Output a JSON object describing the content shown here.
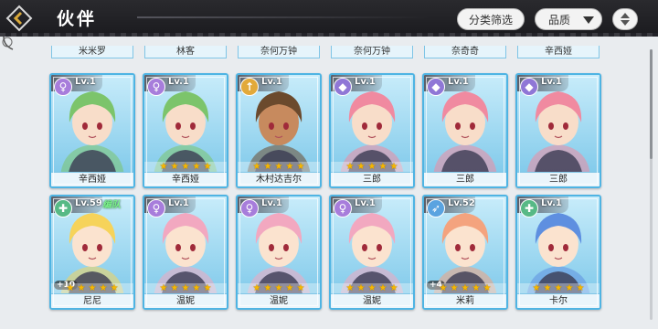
{
  "header": {
    "title": "伙伴",
    "filter_label": "分类筛选",
    "quality_label": "品质"
  },
  "colors": {
    "topbar": "#1b1b1f",
    "card_border": "#4fb4e3",
    "card_bg": "#8fd2ee",
    "star": "#f7b800",
    "team_tag": "#7cf08a"
  },
  "previous_row_names": [
    "米米罗",
    "林客",
    "奈何万钟",
    "奈何万钟",
    "奈奇奇",
    "辛西娅"
  ],
  "rows": [
    [
      {
        "name": "辛西娅",
        "level": "Lv.1",
        "class_icon": "female-icon",
        "icon_color": "ic-purple",
        "stars": 0,
        "team": "",
        "plus": "",
        "hair": "#7cc46b",
        "skin": "#f8ddc9"
      },
      {
        "name": "辛西娅",
        "level": "Lv.1",
        "class_icon": "female-icon",
        "icon_color": "ic-purple",
        "stars": 5,
        "team": "",
        "plus": "",
        "hair": "#7cc46b",
        "skin": "#f8ddc9"
      },
      {
        "name": "木村达吉尔",
        "level": "Lv.1",
        "class_icon": "arrow-up-icon",
        "icon_color": "ic-orange",
        "stars": 5,
        "team": "",
        "plus": "",
        "hair": "#6b4a2d",
        "skin": "#c78a5e"
      },
      {
        "name": "三郎",
        "level": "Lv.1",
        "class_icon": "shield-icon",
        "icon_color": "ic-violet",
        "stars": 5,
        "team": "",
        "plus": "",
        "hair": "#f08aa0",
        "skin": "#f8ddc9"
      },
      {
        "name": "三郎",
        "level": "Lv.1",
        "class_icon": "shield-icon",
        "icon_color": "ic-violet",
        "stars": 0,
        "team": "",
        "plus": "",
        "hair": "#f08aa0",
        "skin": "#f8ddc9"
      },
      {
        "name": "三郎",
        "level": "Lv.1",
        "class_icon": "shield-icon",
        "icon_color": "ic-violet",
        "stars": 0,
        "team": "",
        "plus": "",
        "hair": "#f08aa0",
        "skin": "#f8ddc9"
      }
    ],
    [
      {
        "name": "尼尼",
        "level": "Lv.59",
        "class_icon": "cross-icon",
        "icon_color": "ic-green",
        "stars": 5,
        "team": "编队",
        "plus": "+10",
        "hair": "#f6d35a",
        "skin": "#fbe3cf"
      },
      {
        "name": "温妮",
        "level": "Lv.1",
        "class_icon": "female-icon",
        "icon_color": "ic-purple",
        "stars": 5,
        "team": "",
        "plus": "",
        "hair": "#f2a8c0",
        "skin": "#fbe3cf"
      },
      {
        "name": "温妮",
        "level": "Lv.1",
        "class_icon": "female-icon",
        "icon_color": "ic-purple",
        "stars": 5,
        "team": "",
        "plus": "",
        "hair": "#f2a8c0",
        "skin": "#fbe3cf"
      },
      {
        "name": "温妮",
        "level": "Lv.1",
        "class_icon": "female-icon",
        "icon_color": "ic-purple",
        "stars": 5,
        "team": "",
        "plus": "",
        "hair": "#f2a8c0",
        "skin": "#fbe3cf"
      },
      {
        "name": "米莉",
        "level": "Lv.52",
        "class_icon": "bow-icon",
        "icon_color": "ic-blue",
        "stars": 5,
        "team": "",
        "plus": "+4",
        "hair": "#f4a37e",
        "skin": "#fbe3cf"
      },
      {
        "name": "卡尔",
        "level": "Lv.1",
        "class_icon": "cross-icon",
        "icon_color": "ic-green",
        "stars": 5,
        "team": "",
        "plus": "",
        "hair": "#5e8fe0",
        "skin": "#fbe3cf"
      }
    ]
  ]
}
